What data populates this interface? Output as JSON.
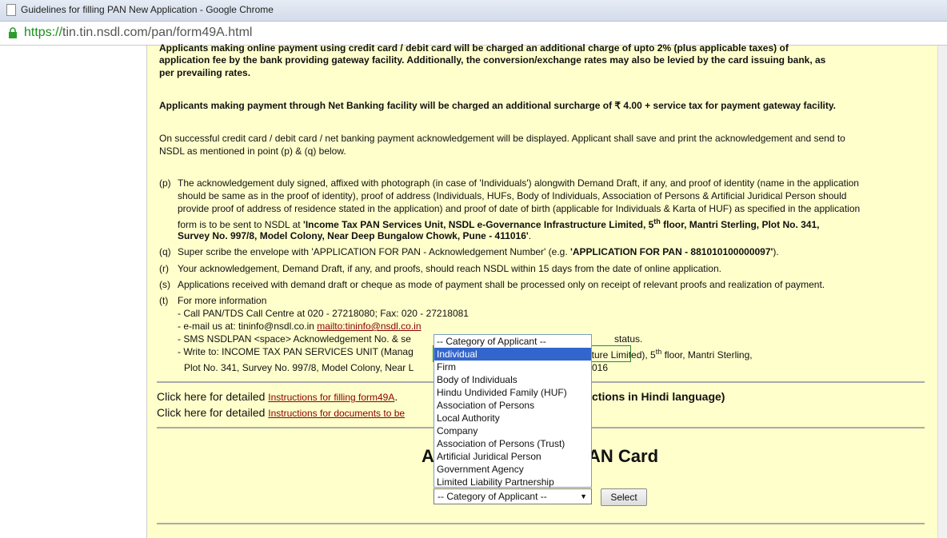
{
  "window": {
    "title": "Guidelines for filling PAN New Application - Google Chrome"
  },
  "address": {
    "scheme": "https://",
    "host": "tin.tin.nsdl.com",
    "path": "/pan/form49A.html"
  },
  "content": {
    "p1_line1": "Applicants making online payment using credit card / debit card will be charged an additional charge of upto 2% (plus applicable taxes) of",
    "p1_line2": "application fee by the bank providing gateway facility. Additionally, the conversion/exchange rates may also be levied by the card issuing bank, as",
    "p1_line3": "per prevailing rates.",
    "p2": "Applicants making payment through Net Banking facility will be charged an additional surcharge of ₹ 4.00 + service tax for payment gateway facility.",
    "p3_line1": "On successful credit card / debit card / net banking payment acknowledgement will be displayed. Applicant shall save and print the acknowledgement and send to",
    "p3_line2": "NSDL as mentioned in point (p) & (q) below.",
    "p_label": "(p)",
    "p_l1": "The acknowledgement duly signed, affixed with photograph (in case of 'Individuals') alongwith Demand Draft, if any, and proof of identity (name in the application",
    "p_l2": "should be same as in the proof of identity), proof of address (Individuals, HUFs, Body of Individuals, Association of Persons & Artificial Juridical Person should",
    "p_l3": "provide proof of address of residence stated in the application) and proof of date of birth (applicable for Individuals & Karta of HUF) as specified in the application",
    "p_l4a": "form is to be sent to NSDL at ",
    "p_l4b": "'Income Tax PAN Services Unit, NSDL e-Governance Infrastructure Limited, 5",
    "p_sup": "th",
    "p_l4c": " floor, Mantri Sterling, Plot No. 341,",
    "p_l5": "Survey No. 997/8, Model Colony, Near Deep Bungalow Chowk, Pune - 411016'",
    "p_l5end": ".",
    "q_label": "(q)",
    "q_a": "Super scribe the envelope with 'APPLICATION FOR PAN - Acknowledgement Number' (e.g. ",
    "q_b": "'APPLICATION FOR PAN - 881010100000097'",
    "q_c": ").",
    "r_label": "(r)",
    "r_text": "Your acknowledgement, Demand Draft, if any, and proofs, should reach NSDL within 15 days from the date of online application.",
    "s_label": "(s)",
    "s_text": "Applications received with demand draft or cheque as mode of payment shall be processed only on receipt of relevant proofs and realization of payment.",
    "t_label": "(t)",
    "t_l1": "For more information",
    "t_l2": "- Call PAN/TDS Call Centre at 020 - 27218080; Fax: 020 - 27218081",
    "t_l3a": "- e-mail us at: tininfo@nsdl.co.in ",
    "t_l3link": "mailto:tininfo@nsdl.co.in",
    "t_l4a": "- SMS NSDLPAN <space> Acknowledgement No. & se",
    "t_l4b": "status.",
    "t_l5a": "- Write to: INCOME TAX PAN SERVICES UNIT (Manag",
    "t_l5b": "ucture Limited), 5",
    "t_l5sup": "th",
    "t_l5c": " floor, Mantri Sterling,",
    "t_l6a": "Plot No. 341, Survey No. 997/8, Model Colony, Near L",
    "t_l6b": "016",
    "click1_a": "Click here for detailed ",
    "click1_link": "Instructions for filling form49A",
    "click1_b": ".",
    "click1_c": "ctions in Hindi language)",
    "click2_a": "Click here for detailed ",
    "click2_link": "Instructions for documents to be",
    "heading_a": "A",
    "heading_b": "AN Card"
  },
  "form": {
    "select_value": "-- Category of Applicant --",
    "select_arrow": "▼",
    "button_label": "Select",
    "options": [
      "-- Category of Applicant --",
      "Individual",
      "Firm",
      "Body of Individuals",
      "Hindu Undivided Family (HUF)",
      "Association of Persons",
      "Local Authority",
      "Company",
      "Association of Persons (Trust)",
      "Artificial Juridical Person",
      "Government Agency",
      "Limited Liability Partnership"
    ],
    "highlighted_option": "Individual"
  }
}
